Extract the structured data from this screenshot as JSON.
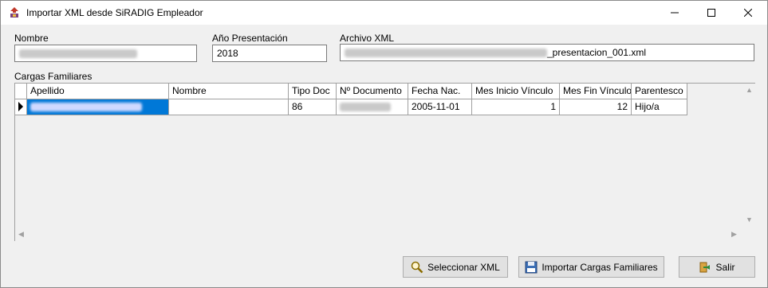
{
  "window": {
    "title": "Importar XML desde SiRADIG Empleador"
  },
  "fields": {
    "nombre_label": "Nombre",
    "anio_label": "Año Presentación",
    "anio_value": "2018",
    "archivo_label": "Archivo XML",
    "archivo_value_suffix": "_presentacion_001.xml"
  },
  "grid": {
    "label": "Cargas Familiares",
    "columns": [
      "Apellido",
      "Nombre",
      "Tipo Doc",
      "Nº Documento",
      "Fecha Nac.",
      "Mes Inicio Vínculo",
      "Mes Fin Vínculo",
      "Parentesco"
    ],
    "rows": [
      {
        "tipo_doc": "86",
        "fecha_nac": "2005-11-01",
        "mes_inicio": "1",
        "mes_fin": "12",
        "parentesco": "Hijo/a"
      }
    ]
  },
  "buttons": {
    "seleccionar": "Seleccionar XML",
    "importar": "Importar Cargas Familiares",
    "salir": "Salir"
  },
  "icons": {
    "app": "siradig-app-icon",
    "seleccionar": "magnifier-icon",
    "importar": "floppy-disk-icon",
    "salir": "exit-icon"
  }
}
